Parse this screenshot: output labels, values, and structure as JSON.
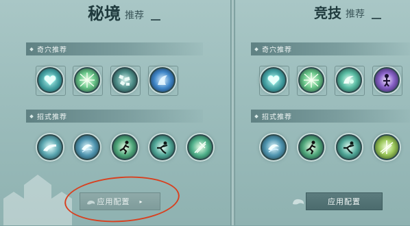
{
  "left_panel": {
    "title_main": "秘境",
    "title_sub": "推荐",
    "talent_section": "奇穴推荐",
    "skill_section": "招式推荐",
    "talent_icons": [
      "heart-shield-icon",
      "lightning-burst-icon",
      "cluster-stone-icon",
      "blue-wave-icon"
    ],
    "skill_icons": [
      "palm-strike-icon",
      "spiral-wind-icon",
      "running-figure-icon",
      "dash-figure-icon",
      "sword-light-icon"
    ],
    "button_label": "应用配置",
    "button_arrow": "▸"
  },
  "right_panel": {
    "title_main": "竞技",
    "title_sub": "推荐",
    "talent_section": "奇穴推荐",
    "skill_section": "招式推荐",
    "talent_icons": [
      "heart-shield-icon",
      "lightning-burst-icon",
      "energy-swirl-icon",
      "figure-aura-icon"
    ],
    "skill_icons": [
      "spiral-wind-icon",
      "running-figure-icon",
      "dash-figure-icon",
      "light-burst-icon"
    ],
    "button_label": "应用配置"
  },
  "colors": {
    "annotation": "#d8401f",
    "panel_bg": "#a9c7c6",
    "title": "#1f3a3d"
  }
}
